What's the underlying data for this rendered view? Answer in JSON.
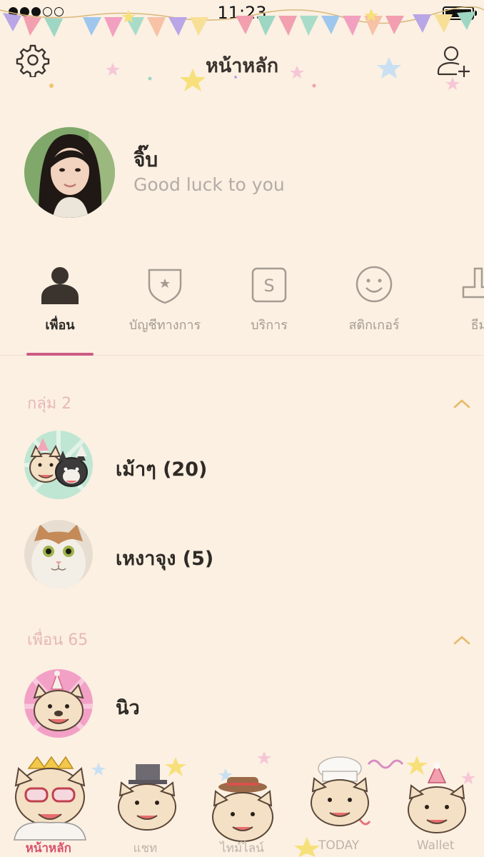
{
  "status_bar": {
    "time": "11:23"
  },
  "header": {
    "title": "หน้าหลัก"
  },
  "profile": {
    "name": "จิ๊บ",
    "status_message": "Good luck to you"
  },
  "tabs": [
    {
      "label": "เพื่อน",
      "icon": "person-icon",
      "active": true
    },
    {
      "label": "บัญชีทางการ",
      "icon": "official-account-icon",
      "active": false
    },
    {
      "label": "บริการ",
      "icon": "services-icon",
      "active": false
    },
    {
      "label": "สติกเกอร์",
      "icon": "smile-icon",
      "active": false
    },
    {
      "label": "ธีม",
      "icon": "theme-icon",
      "active": false
    }
  ],
  "groups": {
    "header": "กลุ่ม 2",
    "items": [
      {
        "name": "เม้าๆ (20)",
        "avatar": "bulldog-group-avatar"
      },
      {
        "name": "เหงาจุง (5)",
        "avatar": "cat-avatar"
      }
    ]
  },
  "friends": {
    "header": "เพื่อน 65",
    "items": [
      {
        "name": "นิว",
        "avatar": "bulldog-avatar"
      }
    ]
  },
  "bottom_nav": [
    {
      "label": "หน้าหลัก",
      "active": true
    },
    {
      "label": "แชท",
      "active": false
    },
    {
      "label": "ไทม์ไลน์",
      "active": false
    },
    {
      "label": "TODAY",
      "active": false
    },
    {
      "label": "Wallet",
      "active": false
    }
  ],
  "colors": {
    "background": "#fbf0e2",
    "accent": "#cc5b84",
    "muted_header": "#e8b7b8",
    "chevron": "#e9b96a"
  }
}
